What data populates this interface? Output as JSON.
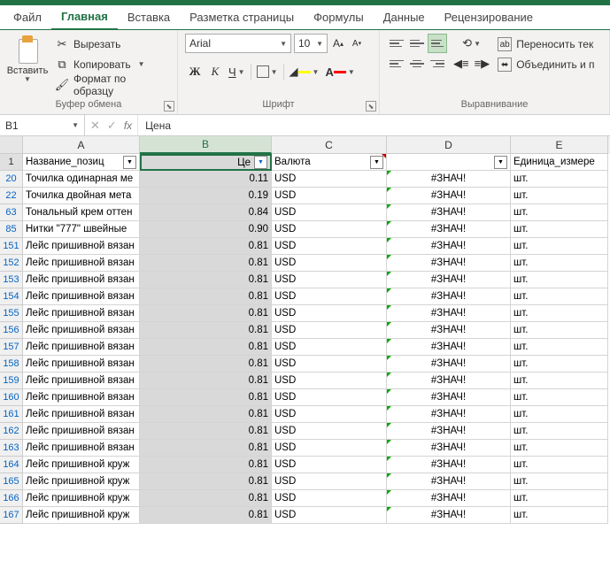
{
  "tabs": [
    "Файл",
    "Главная",
    "Вставка",
    "Разметка страницы",
    "Формулы",
    "Данные",
    "Рецензирование"
  ],
  "activeTab": 1,
  "clipboard": {
    "group": "Буфер обмена",
    "paste": "Вставить",
    "cut": "Вырезать",
    "copy": "Копировать",
    "format": "Формат по образцу"
  },
  "font": {
    "group": "Шрифт",
    "name": "Arial",
    "size": "10",
    "bold": "Ж",
    "italic": "К",
    "underline": "Ч"
  },
  "align": {
    "group": "Выравнивание",
    "wrap": "Переносить тек",
    "merge": "Объединить и п"
  },
  "nameBox": "B1",
  "formulaValue": "Цена",
  "cols": [
    "A",
    "B",
    "C",
    "D",
    "E"
  ],
  "selectedCol": 1,
  "headerRow": {
    "num": "1",
    "a": "Название_позиц",
    "b": "Це",
    "c": "Валюта",
    "d": "",
    "e": "Единица_измере"
  },
  "filterActive": {
    "a": false,
    "b": true,
    "c": false,
    "d": false,
    "e": false
  },
  "rows": [
    {
      "n": "20",
      "a": "Точилка одинарная ме",
      "b": "0.11",
      "c": "USD",
      "d": "#ЗНАЧ!",
      "e": "шт."
    },
    {
      "n": "22",
      "a": "Точилка двойная мета",
      "b": "0.19",
      "c": "USD",
      "d": "#ЗНАЧ!",
      "e": "шт."
    },
    {
      "n": "63",
      "a": "Тональный крем оттен",
      "b": "0.84",
      "c": "USD",
      "d": "#ЗНАЧ!",
      "e": "шт."
    },
    {
      "n": "85",
      "a": "Нитки \"777\" швейные",
      "b": "0.90",
      "c": "USD",
      "d": "#ЗНАЧ!",
      "e": "шт."
    },
    {
      "n": "151",
      "a": "Лейс пришивной вязан",
      "b": "0.81",
      "c": "USD",
      "d": "#ЗНАЧ!",
      "e": "шт."
    },
    {
      "n": "152",
      "a": "Лейс пришивной вязан",
      "b": "0.81",
      "c": "USD",
      "d": "#ЗНАЧ!",
      "e": "шт."
    },
    {
      "n": "153",
      "a": "Лейс пришивной вязан",
      "b": "0.81",
      "c": "USD",
      "d": "#ЗНАЧ!",
      "e": "шт."
    },
    {
      "n": "154",
      "a": "Лейс пришивной вязан",
      "b": "0.81",
      "c": "USD",
      "d": "#ЗНАЧ!",
      "e": "шт."
    },
    {
      "n": "155",
      "a": "Лейс пришивной вязан",
      "b": "0.81",
      "c": "USD",
      "d": "#ЗНАЧ!",
      "e": "шт."
    },
    {
      "n": "156",
      "a": "Лейс пришивной вязан",
      "b": "0.81",
      "c": "USD",
      "d": "#ЗНАЧ!",
      "e": "шт."
    },
    {
      "n": "157",
      "a": "Лейс пришивной вязан",
      "b": "0.81",
      "c": "USD",
      "d": "#ЗНАЧ!",
      "e": "шт."
    },
    {
      "n": "158",
      "a": "Лейс пришивной вязан",
      "b": "0.81",
      "c": "USD",
      "d": "#ЗНАЧ!",
      "e": "шт."
    },
    {
      "n": "159",
      "a": "Лейс пришивной вязан",
      "b": "0.81",
      "c": "USD",
      "d": "#ЗНАЧ!",
      "e": "шт."
    },
    {
      "n": "160",
      "a": "Лейс пришивной вязан",
      "b": "0.81",
      "c": "USD",
      "d": "#ЗНАЧ!",
      "e": "шт."
    },
    {
      "n": "161",
      "a": "Лейс пришивной вязан",
      "b": "0.81",
      "c": "USD",
      "d": "#ЗНАЧ!",
      "e": "шт."
    },
    {
      "n": "162",
      "a": "Лейс пришивной вязан",
      "b": "0.81",
      "c": "USD",
      "d": "#ЗНАЧ!",
      "e": "шт."
    },
    {
      "n": "163",
      "a": "Лейс пришивной вязан",
      "b": "0.81",
      "c": "USD",
      "d": "#ЗНАЧ!",
      "e": "шт."
    },
    {
      "n": "164",
      "a": "Лейс пришивной круж",
      "b": "0.81",
      "c": "USD",
      "d": "#ЗНАЧ!",
      "e": "шт."
    },
    {
      "n": "165",
      "a": "Лейс пришивной круж",
      "b": "0.81",
      "c": "USD",
      "d": "#ЗНАЧ!",
      "e": "шт."
    },
    {
      "n": "166",
      "a": "Лейс пришивной круж",
      "b": "0.81",
      "c": "USD",
      "d": "#ЗНАЧ!",
      "e": "шт."
    },
    {
      "n": "167",
      "a": "Лейс пришивной круж",
      "b": "0.81",
      "c": "USD",
      "d": "#ЗНАЧ!",
      "e": "шт."
    }
  ]
}
